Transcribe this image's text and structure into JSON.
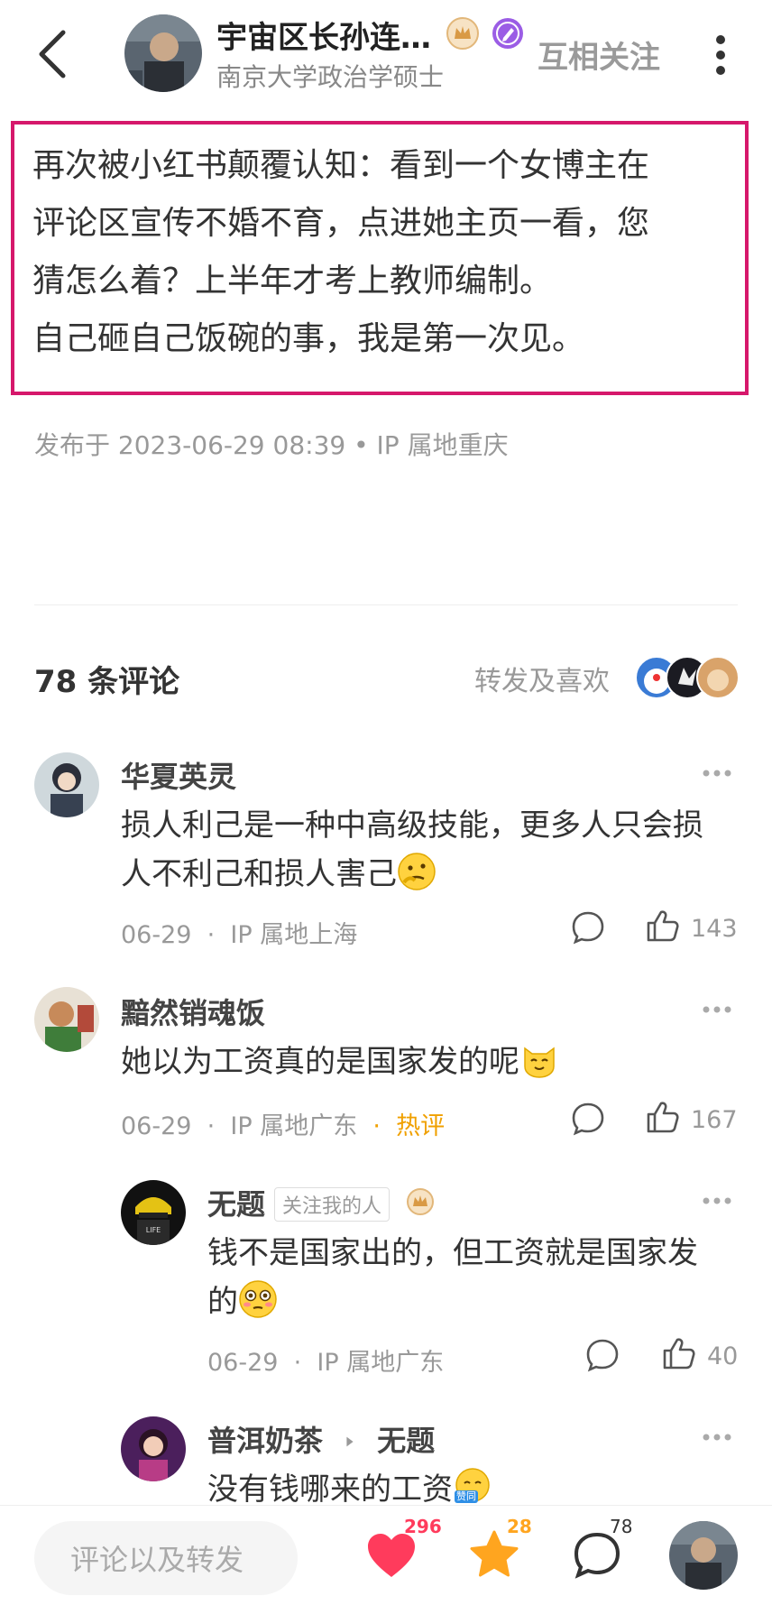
{
  "header": {
    "author_name": "宇宙区长孙连…",
    "author_sub": "南京大学政治学硕士",
    "follow_label": "互相关注"
  },
  "post": {
    "lines": [
      "再次被小红书颠覆认知：看到一个女博主在",
      "评论区宣传不婚不育，点进她主页一看，您",
      "猜怎么着？上半年才考上教师编制。",
      "自己砸自己饭碗的事，我是第一次见。"
    ],
    "meta": "发布于 2023-06-29 08:39 • IP 属地重庆"
  },
  "comments_header": {
    "count_label": "78 条评论",
    "forward_label": "转发及喜欢"
  },
  "comments": [
    {
      "name": "华夏英灵",
      "text_lines": [
        "损人利己是一种中高级技能，更多人只会损",
        "人不利己和损人害己"
      ],
      "emoji": "thinking-face-emoji",
      "date": "06-29",
      "ip": "IP 属地上海",
      "likes": "143"
    },
    {
      "name": "黯然销魂饭",
      "text": "她以为工资真的是国家发的呢",
      "emoji": "cat-face-emoji",
      "date": "06-29",
      "ip": "IP 属地广东",
      "tag": "热评",
      "likes": "167"
    },
    {
      "name": "无题",
      "badge": "关注我的人",
      "text_lines": [
        "钱不是国家出的，但工资就是国家发",
        "的"
      ],
      "emoji": "flushed-face-emoji",
      "date": "06-29",
      "ip": "IP 属地广东",
      "likes": "40"
    },
    {
      "name": "普洱奶茶",
      "reply_to": "无题",
      "text": "没有钱哪来的工资",
      "emoji": "agree-emoji",
      "emoji_label": "赞同"
    }
  ],
  "separator": "·",
  "bottom_bar": {
    "input_placeholder": "评论以及转发",
    "likes": "296",
    "favorites": "28",
    "comments": "78"
  },
  "colors": {
    "highlight_border": "#d6176b",
    "heart": "#ff3b5c",
    "star": "#ffa51f",
    "hot_tag": "#f0a000"
  }
}
